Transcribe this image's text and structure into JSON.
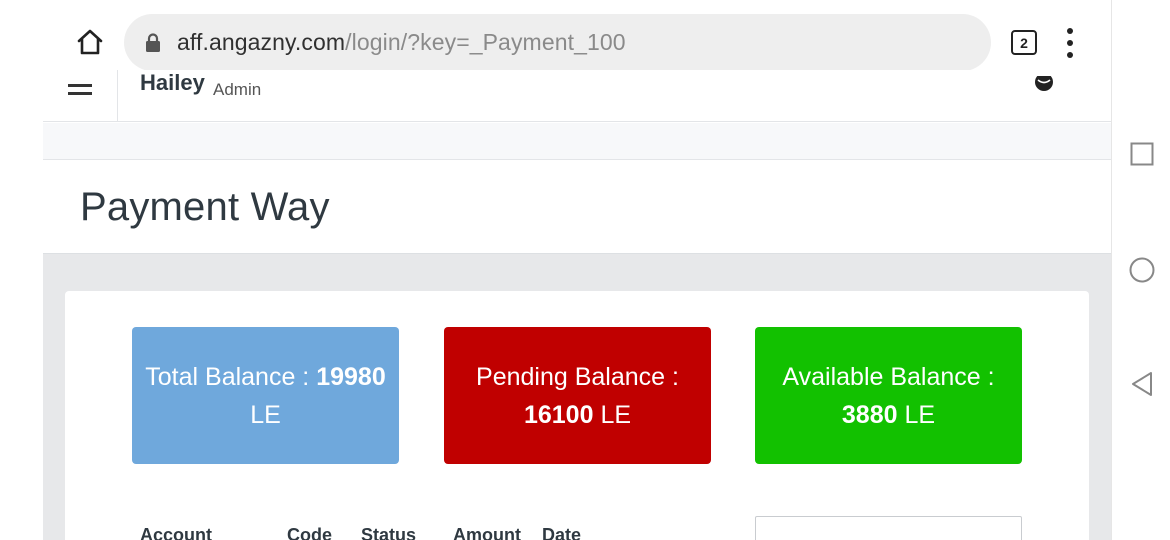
{
  "browser": {
    "url_host": "aff.angazny.com",
    "url_path": "/login/?key=_Payment_100",
    "tab_count": "2",
    "icons": {
      "home": "home-icon",
      "lock": "lock-icon",
      "menu": "more-vert-icon"
    }
  },
  "header": {
    "user_name": "Hailey",
    "user_role": "Admin",
    "icons": {
      "menu": "hamburger-icon",
      "language": "globe-icon"
    }
  },
  "page": {
    "title": "Payment Way"
  },
  "balances": {
    "total": {
      "label": "Total Balance : ",
      "amount": "19980",
      "currency": "LE",
      "color": "#6fa8dc"
    },
    "pending": {
      "label": "Pending Balance : ",
      "amount": "16100",
      "currency": "LE",
      "color": "#c00000"
    },
    "available": {
      "label": "Available Balance : ",
      "amount": "3880",
      "currency": "LE",
      "color": "#12c100"
    }
  },
  "table": {
    "columns": [
      "Account",
      "Code",
      "Status",
      "Amount",
      "Date"
    ]
  },
  "system_nav": {
    "icons": {
      "recents": "square-recents-icon",
      "home": "circle-home-icon",
      "back": "triangle-back-icon"
    }
  }
}
